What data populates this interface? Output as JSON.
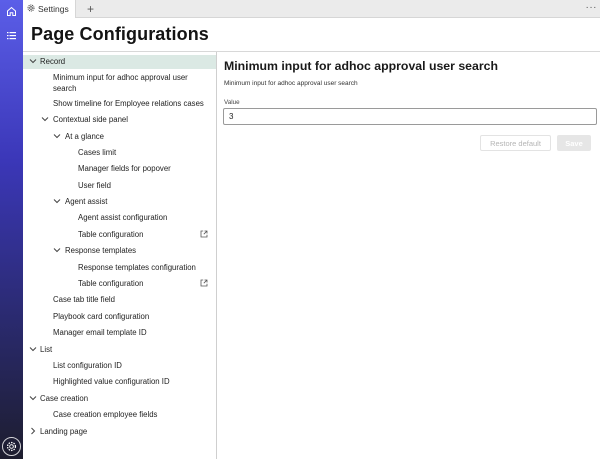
{
  "tab": {
    "label": "Settings",
    "add_label": "+",
    "more_label": "···"
  },
  "header": {
    "title": "Page Configurations"
  },
  "nav": {
    "record": "Record",
    "min_input": "Minimum input for adhoc approval user search",
    "show_timeline": "Show timeline for Employee relations cases",
    "contextual_panel": "Contextual side panel",
    "at_a_glance": "At a glance",
    "cases_limit": "Cases limit",
    "manager_fields": "Manager fields for popover",
    "user_field": "User field",
    "agent_assist": "Agent assist",
    "agent_assist_config": "Agent assist configuration",
    "table_config_1": "Table configuration",
    "response_templates": "Response templates",
    "response_templates_config": "Response templates configuration",
    "table_config_2": "Table configuration",
    "case_tab_title": "Case tab title field",
    "playbook_card": "Playbook card configuration",
    "manager_email": "Manager email template ID",
    "list": "List",
    "list_config_id": "List configuration ID",
    "highlighted_value": "Highlighted value configuration ID",
    "case_creation": "Case creation",
    "case_creation_fields": "Case creation employee fields",
    "landing_page": "Landing page"
  },
  "detail": {
    "title": "Minimum input for adhoc approval user search",
    "description": "Minimum input for adhoc approval user search",
    "value_label": "Value",
    "value": "3",
    "restore_label": "Restore default",
    "save_label": "Save"
  }
}
